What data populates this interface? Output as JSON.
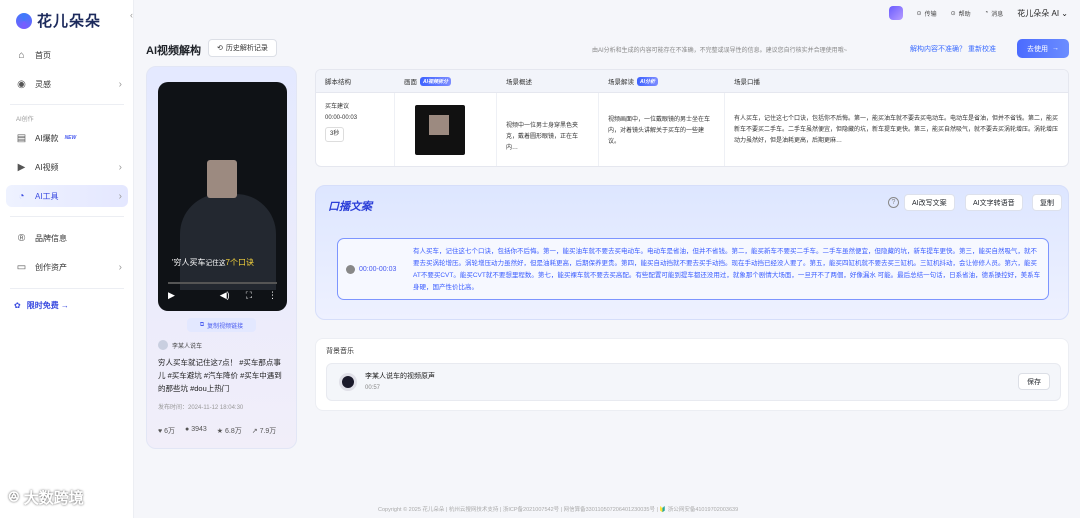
{
  "app": {
    "logo": "花儿朵朵",
    "collapse_icon": "chevron-left-icon"
  },
  "sidebar": {
    "items": [
      {
        "label": "首页",
        "icon": "home-icon"
      },
      {
        "label": "灵感",
        "icon": "location-icon"
      }
    ],
    "section_label": "AI创作",
    "ai_items": [
      {
        "label": "AI爆款",
        "badge": "NEW",
        "icon": "layout-icon"
      },
      {
        "label": "AI视频",
        "icon": "video-icon"
      },
      {
        "label": "AI工具",
        "icon": "tool-icon"
      }
    ],
    "bottom_items": [
      {
        "label": "品牌信息",
        "icon": "brand-icon"
      },
      {
        "label": "创作资产",
        "icon": "folder-icon"
      }
    ],
    "promo": "限时免费 →"
  },
  "topbar": {
    "share": "传输",
    "help": "帮助",
    "msg": "消息",
    "user": "花儿朵朵 AI ⌄"
  },
  "header": {
    "title": "AI视频解构",
    "history_btn": "历史解析记录",
    "notice": "由AI分析和生成的内容可能存在不准确，不完整或误导性的信息。建议您自行核实并合理使用哦~",
    "feedback": "解构内容不准确？ 重新校准",
    "use_btn": "去使用"
  },
  "video_card": {
    "caption_pre": "'穷人买车",
    "caption_mid": "记住这",
    "caption_hl": "7个口诀",
    "copy_link": "复制视频链接",
    "author": "李某人说车",
    "desc": "穷人买车就记住这7点！ #买车那点事儿 #买车避坑 #汽车降价 #买车中遇到的那些坑 #dou上热门",
    "date": "发布时间：2024-11-12 18:04:30",
    "stats": {
      "likes": "6万",
      "comments": "3943",
      "favs": "6.8万",
      "shares": "7.9万"
    }
  },
  "table": {
    "headers": {
      "structure": "脚本结构",
      "frame": "画面",
      "scene": "场景概述",
      "interp": "场景解读",
      "speech": "场景口播"
    },
    "frame_badge": "AI视频拆分",
    "interp_badge": "AI分析",
    "row": {
      "name": "买车建议",
      "time": "00:00-00:03",
      "dur": "3秒",
      "scene": "视频中一位男士身穿黑色夹克，戴着圆形眼镜，正在车内…",
      "interp": "视频画面中，一位戴眼镜的男士坐在车内，对着镜头讲解关于买车的一些建议。",
      "speech": "有人买车，记住这七个口诀，包括你不后悔。第一，能买油车就不要去买电动车。电动车是省油，但并不省钱。第二，能买新车不要买二手车。二手车虽然便宜，但隐藏的坑，新车提车更快。第三，能买自然吸气，就不要去买涡轮增压。涡轮增压动力虽然好，但是油耗更高，后期更麻…"
    }
  },
  "script": {
    "title": "口播文案",
    "rewrite_btn": "AI改写文案",
    "tts_btn": "AI文字转语音",
    "copy_btn": "复制",
    "timestamp": "00:00-00:03",
    "text": "有人买车，记住这七个口诀，包括你不后悔。第一，能买油车就不要去买电动车。电动车是省油，但并不省钱。第二，能买新车不要买二手车。二手车虽然便宜，但隐藏的坑，新车提车更快。第三，能买自然吸气，就不要去买涡轮增压。涡轮增压动力虽然好，但是油耗更高，后期保养更贵。第四，能买自动挡就不要去买手动挡。现在手动挡已经没人要了。第五，能买四缸机就不要去买三缸机。三缸机抖动，会让修修人员。第六，能买AT不要买CVT。能买CVT就不要想里程数。第七，能买裸车就不要去买高配。有些配置可能到提车都还没用过，就象那个剧情大场面，一旦开不了两個，好像漏水 可能。最后总结一句话，日系省油，德系操控好，美系车身硬，国产性价比高。"
  },
  "music": {
    "label": "背景音乐",
    "track": "李某人说车的视频原声",
    "duration": "00:57",
    "save": "保存"
  },
  "footer": "Copyright © 2025 花儿朵朵 | 杭州云搜网技术支持 | 浙ICP备2021007542号 | 网信算备330110507206401230035号 | 🔰 浙公网安备41019702003639",
  "watermark": "大数跨境"
}
